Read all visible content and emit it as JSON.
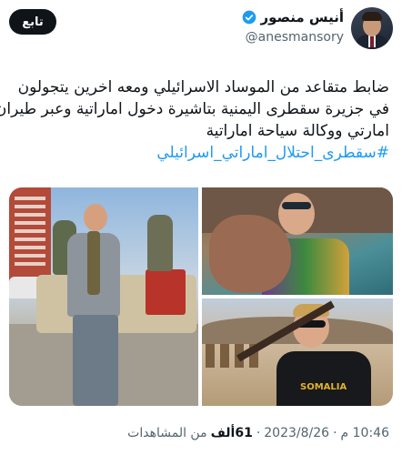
{
  "user": {
    "name": "أنيس منصور",
    "handle": "@anesmansory"
  },
  "follow_label": "تابع",
  "tweet": {
    "lines": [
      "ضابط متقاعد من الموساد الاسرائيلي ومعه اخرين يتجولون",
      "في جزيرة سقطرى اليمنية بتاشيرة دخول اماراتية وعبر طيران",
      "امارتي ووكالة سياحة اماراتية"
    ],
    "hashtag": "#سقطرى_احتلال_اماراتي_اسرائيلي"
  },
  "media": {
    "shirt_text": "SOMALIA"
  },
  "meta": {
    "time": "10:46 م",
    "separator": "·",
    "date": "2023/8/26",
    "views_count": "61ألف",
    "views_label": "من المشاهدات"
  },
  "colors": {
    "link": "#1d9bf0",
    "verified": "#1d9bf0",
    "follow_bg": "#0f1419"
  }
}
